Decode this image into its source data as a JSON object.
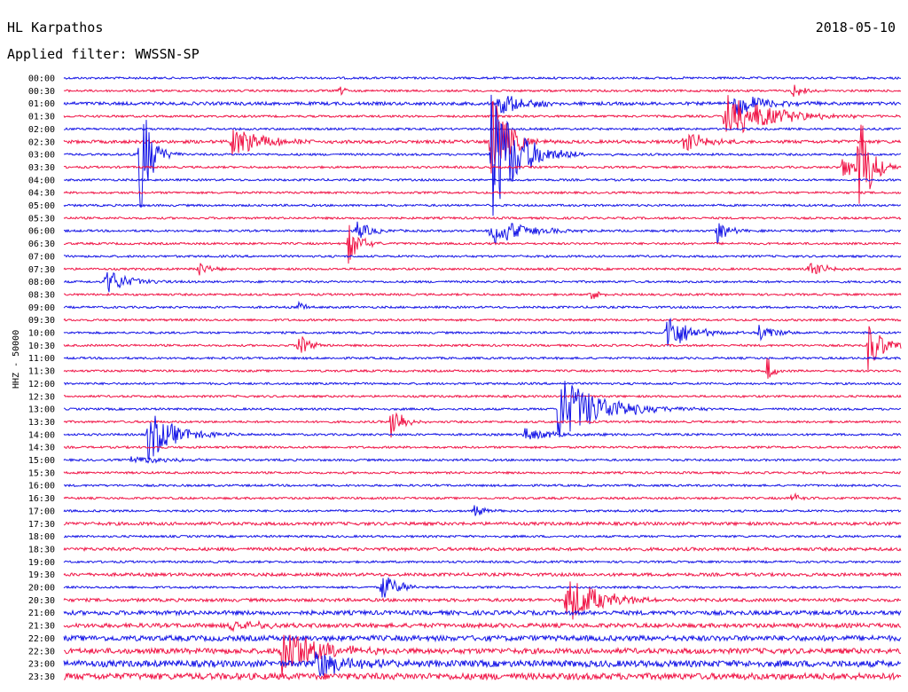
{
  "header": {
    "station": "HL Karpathos",
    "date": "2018-05-10",
    "filter": "Applied filter: WWSSN-SP"
  },
  "chart_data": {
    "type": "line",
    "title": "HL Karpathos",
    "ylabel": "HHZ - 50000",
    "colors": {
      "a": "#1414e6",
      "b": "#f01446"
    },
    "row_labels": [
      "00:00",
      "00:30",
      "01:00",
      "01:30",
      "02:00",
      "02:30",
      "03:00",
      "03:30",
      "04:00",
      "04:30",
      "05:00",
      "05:30",
      "06:00",
      "06:30",
      "07:00",
      "07:30",
      "08:00",
      "08:30",
      "09:00",
      "09:30",
      "10:00",
      "10:30",
      "11:00",
      "11:30",
      "12:00",
      "12:30",
      "13:00",
      "13:30",
      "14:00",
      "14:30",
      "15:00",
      "15:30",
      "16:00",
      "16:30",
      "17:00",
      "17:30",
      "18:00",
      "18:30",
      "19:00",
      "19:30",
      "20:00",
      "20:30",
      "21:00",
      "21:30",
      "22:00",
      "22:30",
      "23:00",
      "23:30"
    ],
    "noise": [
      2,
      2,
      3,
      2,
      2,
      3,
      2,
      2,
      2,
      2,
      2,
      2,
      2,
      2,
      2,
      2,
      2,
      2,
      2,
      2,
      2,
      2,
      2,
      2,
      2,
      2,
      2,
      2,
      2,
      2,
      2,
      2,
      2,
      2,
      2,
      3,
      2,
      3,
      2,
      3,
      2,
      3,
      4,
      4,
      5,
      5,
      6,
      6
    ],
    "events": [
      {
        "row": 1,
        "t": 0.33,
        "amp": 8,
        "dur": 0.01
      },
      {
        "row": 1,
        "t": 0.87,
        "amp": 10,
        "dur": 0.02
      },
      {
        "row": 2,
        "t": 0.52,
        "amp": 15,
        "dur": 0.05
      },
      {
        "row": 2,
        "t": 0.8,
        "amp": 18,
        "dur": 0.05
      },
      {
        "row": 3,
        "t": 0.79,
        "amp": 30,
        "dur": 0.08
      },
      {
        "row": 5,
        "t": 0.2,
        "amp": 18,
        "dur": 0.06
      },
      {
        "row": 5,
        "t": 0.74,
        "amp": 14,
        "dur": 0.04
      },
      {
        "row": 5,
        "t": 0.51,
        "amp": 60,
        "dur": 0.03
      },
      {
        "row": 6,
        "t": 0.09,
        "amp": 85,
        "dur": 0.02
      },
      {
        "row": 6,
        "t": 0.51,
        "amp": 80,
        "dur": 0.05
      },
      {
        "row": 7,
        "t": 0.95,
        "amp": 80,
        "dur": 0.02
      },
      {
        "row": 7,
        "t": 0.93,
        "amp": 14,
        "dur": 0.03
      },
      {
        "row": 12,
        "t": 0.35,
        "amp": 10,
        "dur": 0.03
      },
      {
        "row": 12,
        "t": 0.51,
        "amp": 18,
        "dur": 0.06
      },
      {
        "row": 12,
        "t": 0.78,
        "amp": 16,
        "dur": 0.02
      },
      {
        "row": 13,
        "t": 0.34,
        "amp": 25,
        "dur": 0.02
      },
      {
        "row": 15,
        "t": 0.16,
        "amp": 10,
        "dur": 0.02
      },
      {
        "row": 15,
        "t": 0.89,
        "amp": 10,
        "dur": 0.03
      },
      {
        "row": 16,
        "t": 0.05,
        "amp": 16,
        "dur": 0.04
      },
      {
        "row": 17,
        "t": 0.63,
        "amp": 8,
        "dur": 0.02
      },
      {
        "row": 18,
        "t": 0.28,
        "amp": 10,
        "dur": 0.01
      },
      {
        "row": 20,
        "t": 0.72,
        "amp": 25,
        "dur": 0.04
      },
      {
        "row": 20,
        "t": 0.83,
        "amp": 12,
        "dur": 0.03
      },
      {
        "row": 21,
        "t": 0.28,
        "amp": 16,
        "dur": 0.02
      },
      {
        "row": 21,
        "t": 0.96,
        "amp": 30,
        "dur": 0.03
      },
      {
        "row": 23,
        "t": 0.84,
        "amp": 20,
        "dur": 0.01
      },
      {
        "row": 26,
        "t": 0.59,
        "amp": 40,
        "dur": 0.08
      },
      {
        "row": 27,
        "t": 0.39,
        "amp": 28,
        "dur": 0.02
      },
      {
        "row": 28,
        "t": 0.1,
        "amp": 30,
        "dur": 0.05
      },
      {
        "row": 28,
        "t": 0.55,
        "amp": 7,
        "dur": 0.06
      },
      {
        "row": 30,
        "t": 0.08,
        "amp": 6,
        "dur": 0.06
      },
      {
        "row": 33,
        "t": 0.87,
        "amp": 8,
        "dur": 0.02
      },
      {
        "row": 34,
        "t": 0.49,
        "amp": 8,
        "dur": 0.02
      },
      {
        "row": 40,
        "t": 0.38,
        "amp": 18,
        "dur": 0.03
      },
      {
        "row": 41,
        "t": 0.6,
        "amp": 30,
        "dur": 0.06
      },
      {
        "row": 43,
        "t": 0.2,
        "amp": 10,
        "dur": 0.04
      },
      {
        "row": 45,
        "t": 0.26,
        "amp": 35,
        "dur": 0.06
      },
      {
        "row": 46,
        "t": 0.3,
        "amp": 20,
        "dur": 0.06
      }
    ]
  }
}
